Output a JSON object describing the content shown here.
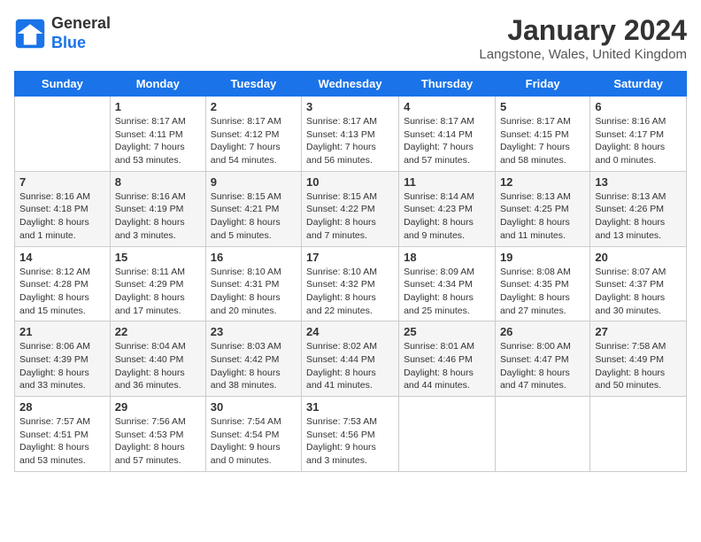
{
  "header": {
    "logo_line1": "General",
    "logo_line2": "Blue",
    "title": "January 2024",
    "subtitle": "Langstone, Wales, United Kingdom"
  },
  "days_of_week": [
    "Sunday",
    "Monday",
    "Tuesday",
    "Wednesday",
    "Thursday",
    "Friday",
    "Saturday"
  ],
  "weeks": [
    [
      {
        "num": "",
        "info": ""
      },
      {
        "num": "1",
        "info": "Sunrise: 8:17 AM\nSunset: 4:11 PM\nDaylight: 7 hours\nand 53 minutes."
      },
      {
        "num": "2",
        "info": "Sunrise: 8:17 AM\nSunset: 4:12 PM\nDaylight: 7 hours\nand 54 minutes."
      },
      {
        "num": "3",
        "info": "Sunrise: 8:17 AM\nSunset: 4:13 PM\nDaylight: 7 hours\nand 56 minutes."
      },
      {
        "num": "4",
        "info": "Sunrise: 8:17 AM\nSunset: 4:14 PM\nDaylight: 7 hours\nand 57 minutes."
      },
      {
        "num": "5",
        "info": "Sunrise: 8:17 AM\nSunset: 4:15 PM\nDaylight: 7 hours\nand 58 minutes."
      },
      {
        "num": "6",
        "info": "Sunrise: 8:16 AM\nSunset: 4:17 PM\nDaylight: 8 hours\nand 0 minutes."
      }
    ],
    [
      {
        "num": "7",
        "info": "Sunrise: 8:16 AM\nSunset: 4:18 PM\nDaylight: 8 hours\nand 1 minute."
      },
      {
        "num": "8",
        "info": "Sunrise: 8:16 AM\nSunset: 4:19 PM\nDaylight: 8 hours\nand 3 minutes."
      },
      {
        "num": "9",
        "info": "Sunrise: 8:15 AM\nSunset: 4:21 PM\nDaylight: 8 hours\nand 5 minutes."
      },
      {
        "num": "10",
        "info": "Sunrise: 8:15 AM\nSunset: 4:22 PM\nDaylight: 8 hours\nand 7 minutes."
      },
      {
        "num": "11",
        "info": "Sunrise: 8:14 AM\nSunset: 4:23 PM\nDaylight: 8 hours\nand 9 minutes."
      },
      {
        "num": "12",
        "info": "Sunrise: 8:13 AM\nSunset: 4:25 PM\nDaylight: 8 hours\nand 11 minutes."
      },
      {
        "num": "13",
        "info": "Sunrise: 8:13 AM\nSunset: 4:26 PM\nDaylight: 8 hours\nand 13 minutes."
      }
    ],
    [
      {
        "num": "14",
        "info": "Sunrise: 8:12 AM\nSunset: 4:28 PM\nDaylight: 8 hours\nand 15 minutes."
      },
      {
        "num": "15",
        "info": "Sunrise: 8:11 AM\nSunset: 4:29 PM\nDaylight: 8 hours\nand 17 minutes."
      },
      {
        "num": "16",
        "info": "Sunrise: 8:10 AM\nSunset: 4:31 PM\nDaylight: 8 hours\nand 20 minutes."
      },
      {
        "num": "17",
        "info": "Sunrise: 8:10 AM\nSunset: 4:32 PM\nDaylight: 8 hours\nand 22 minutes."
      },
      {
        "num": "18",
        "info": "Sunrise: 8:09 AM\nSunset: 4:34 PM\nDaylight: 8 hours\nand 25 minutes."
      },
      {
        "num": "19",
        "info": "Sunrise: 8:08 AM\nSunset: 4:35 PM\nDaylight: 8 hours\nand 27 minutes."
      },
      {
        "num": "20",
        "info": "Sunrise: 8:07 AM\nSunset: 4:37 PM\nDaylight: 8 hours\nand 30 minutes."
      }
    ],
    [
      {
        "num": "21",
        "info": "Sunrise: 8:06 AM\nSunset: 4:39 PM\nDaylight: 8 hours\nand 33 minutes."
      },
      {
        "num": "22",
        "info": "Sunrise: 8:04 AM\nSunset: 4:40 PM\nDaylight: 8 hours\nand 36 minutes."
      },
      {
        "num": "23",
        "info": "Sunrise: 8:03 AM\nSunset: 4:42 PM\nDaylight: 8 hours\nand 38 minutes."
      },
      {
        "num": "24",
        "info": "Sunrise: 8:02 AM\nSunset: 4:44 PM\nDaylight: 8 hours\nand 41 minutes."
      },
      {
        "num": "25",
        "info": "Sunrise: 8:01 AM\nSunset: 4:46 PM\nDaylight: 8 hours\nand 44 minutes."
      },
      {
        "num": "26",
        "info": "Sunrise: 8:00 AM\nSunset: 4:47 PM\nDaylight: 8 hours\nand 47 minutes."
      },
      {
        "num": "27",
        "info": "Sunrise: 7:58 AM\nSunset: 4:49 PM\nDaylight: 8 hours\nand 50 minutes."
      }
    ],
    [
      {
        "num": "28",
        "info": "Sunrise: 7:57 AM\nSunset: 4:51 PM\nDaylight: 8 hours\nand 53 minutes."
      },
      {
        "num": "29",
        "info": "Sunrise: 7:56 AM\nSunset: 4:53 PM\nDaylight: 8 hours\nand 57 minutes."
      },
      {
        "num": "30",
        "info": "Sunrise: 7:54 AM\nSunset: 4:54 PM\nDaylight: 9 hours\nand 0 minutes."
      },
      {
        "num": "31",
        "info": "Sunrise: 7:53 AM\nSunset: 4:56 PM\nDaylight: 9 hours\nand 3 minutes."
      },
      {
        "num": "",
        "info": ""
      },
      {
        "num": "",
        "info": ""
      },
      {
        "num": "",
        "info": ""
      }
    ]
  ]
}
